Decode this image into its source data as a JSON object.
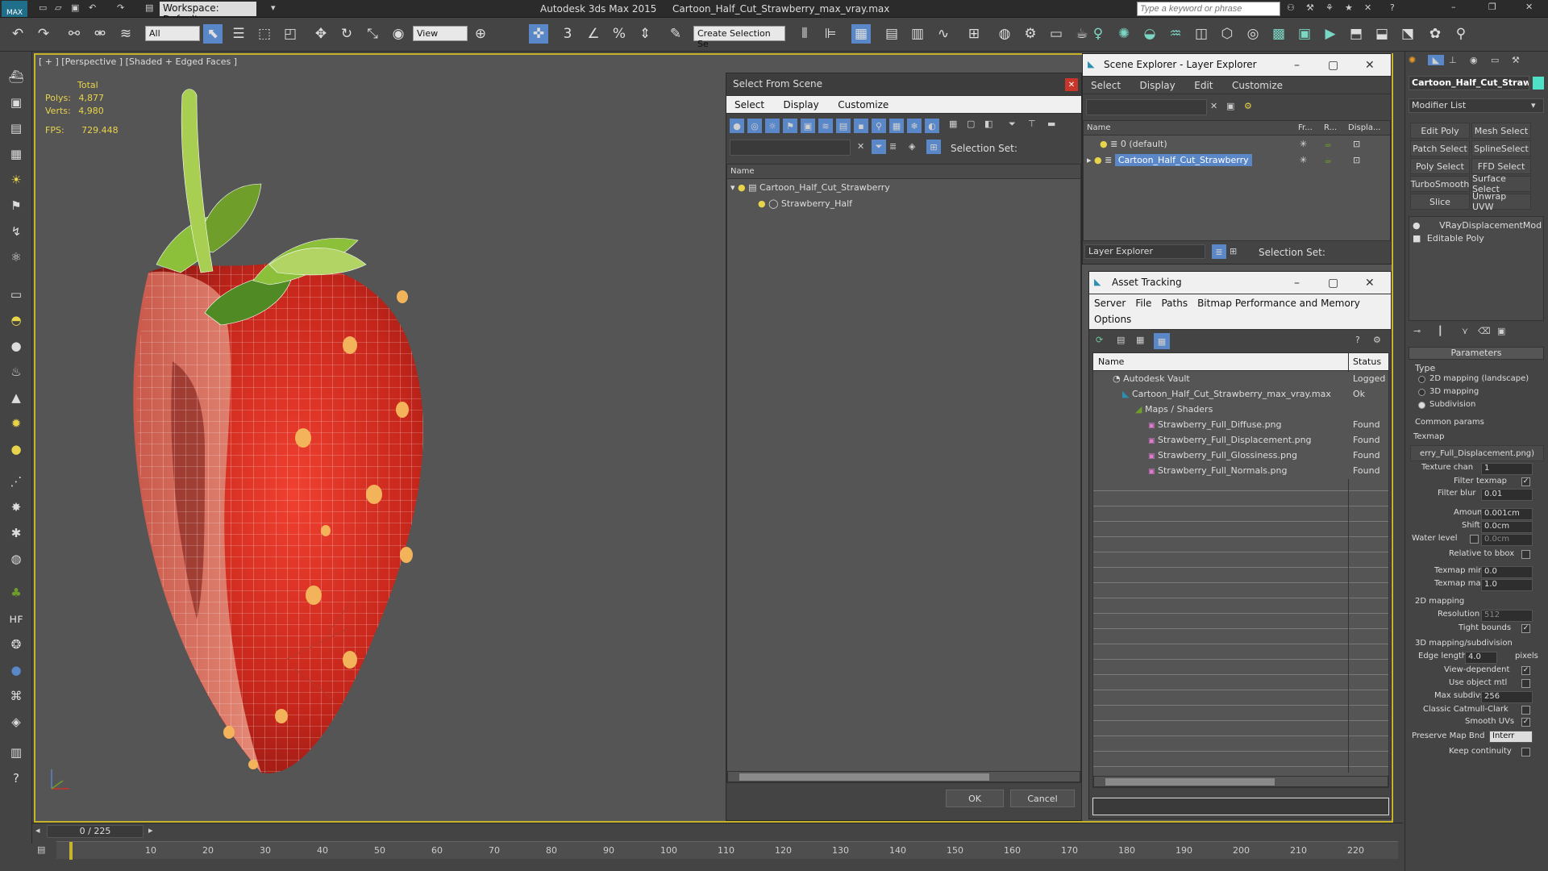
{
  "app": {
    "workspace": "Workspace: Default",
    "title": "Autodesk 3ds Max  2015",
    "filename": "Cartoon_Half_Cut_Strawberry_max_vray.max",
    "search_placeholder": "Type a keyword or phrase",
    "logo": "MAX"
  },
  "toolbar": {
    "filter_select": "All",
    "view_select": "View",
    "selection_set": "Create Selection Se"
  },
  "viewport": {
    "label": "[ + ] [Perspective ] [Shaded + Edged Faces ]",
    "stats_total": "Total",
    "polys_label": "Polys:",
    "polys_value": "4,877",
    "verts_label": "Verts:",
    "verts_value": "4,980",
    "fps_label": "FPS:",
    "fps_value": "729.448"
  },
  "select_from_scene": {
    "title": "Select From Scene",
    "menu": [
      "Select",
      "Display",
      "Customize"
    ],
    "selection_set_label": "Selection Set:",
    "col_name": "Name",
    "rows": [
      "Cartoon_Half_Cut_Strawberry",
      "Strawberry_Half"
    ],
    "ok": "OK",
    "cancel": "Cancel"
  },
  "scene_explorer": {
    "title": "Scene Explorer - Layer Explorer",
    "menu": [
      "Select",
      "Display",
      "Edit",
      "Customize"
    ],
    "col_name": "Name",
    "col_fr": "Fr...",
    "col_r": "R...",
    "col_disp": "Displa...",
    "rows": [
      "0 (default)",
      "Cartoon_Half_Cut_Strawberry"
    ],
    "footer_select": "Layer Explorer",
    "selection_set_label": "Selection Set:"
  },
  "asset_tracking": {
    "title": "Asset Tracking",
    "menu": [
      "Server",
      "File",
      "Paths",
      "Bitmap Performance and Memory",
      "Options"
    ],
    "col_name": "Name",
    "col_status": "Status",
    "rows": [
      {
        "name": "Autodesk Vault",
        "status": "Logged"
      },
      {
        "name": "Cartoon_Half_Cut_Strawberry_max_vray.max",
        "status": "Ok"
      },
      {
        "name": "Maps / Shaders",
        "status": ""
      },
      {
        "name": "Strawberry_Full_Diffuse.png",
        "status": "Found"
      },
      {
        "name": "Strawberry_Full_Displacement.png",
        "status": "Found"
      },
      {
        "name": "Strawberry_Full_Glossiness.png",
        "status": "Found"
      },
      {
        "name": "Strawberry_Full_Normals.png",
        "status": "Found"
      }
    ]
  },
  "command_panel": {
    "object_name": "Cartoon_Half_Cut_Straw",
    "modifier_list": "Modifier List",
    "buttons": [
      "Edit Poly",
      "Mesh Select",
      "Patch Select",
      "SplineSelect",
      "Poly Select",
      "FFD Select",
      "TurboSmooth",
      "Surface Select",
      "Slice",
      "Unwrap UVW"
    ],
    "stack": [
      "VRayDisplacementMod",
      "Editable Poly"
    ],
    "rollout": "Parameters",
    "type_label": "Type",
    "type_options": [
      "2D mapping (landscape)",
      "3D mapping",
      "Subdivision"
    ],
    "common_params": "Common params",
    "texmap_label": "Texmap",
    "texmap_value": "erry_Full_Displacement.png)",
    "texture_chan_label": "Texture chan",
    "texture_chan_value": "1",
    "filter_texmap_label": "Filter texmap",
    "filter_blur_label": "Filter blur",
    "filter_blur_value": "0.01",
    "amount_label": "Amount",
    "amount_value": "0.001cm",
    "shift_label": "Shift",
    "shift_value": "0.0cm",
    "water_level_label": "Water level",
    "water_level_value": "0.0cm",
    "relative_bbox_label": "Relative to bbox",
    "texmap_min_label": "Texmap min",
    "texmap_min_value": "0.0",
    "texmap_max_label": "Texmap max",
    "texmap_max_value": "1.0",
    "mapping2d_label": "2D mapping",
    "resolution_label": "Resolution",
    "resolution_value": "512",
    "tight_bounds_label": "Tight bounds",
    "mapping3d_label": "3D mapping/subdivision",
    "edge_length_label": "Edge length",
    "edge_length_value": "4.0",
    "pixels_label": "pixels",
    "view_dependent_label": "View-dependent",
    "use_object_mtl_label": "Use object mtl",
    "max_subdivs_label": "Max subdivs",
    "max_subdivs_value": "256",
    "classic_catmull_label": "Classic Catmull-Clark",
    "smooth_uvs_label": "Smooth UVs",
    "preserve_map_label": "Preserve Map Bnd",
    "preserve_map_value": "Interr",
    "keep_continuity_label": "Keep continuity"
  },
  "timeline": {
    "frame": "0 / 225",
    "ticks": [
      "10",
      "20",
      "30",
      "40",
      "50",
      "60",
      "70",
      "80",
      "90",
      "100",
      "110",
      "120",
      "130",
      "140",
      "150",
      "160",
      "170",
      "180",
      "190",
      "200",
      "210",
      "220"
    ]
  },
  "colors": {
    "accent_yellow": "#c8b42a",
    "selection_blue": "#5a87c8",
    "strawberry_red": "#d62a1e",
    "leaf_green": "#6f9e2a"
  }
}
